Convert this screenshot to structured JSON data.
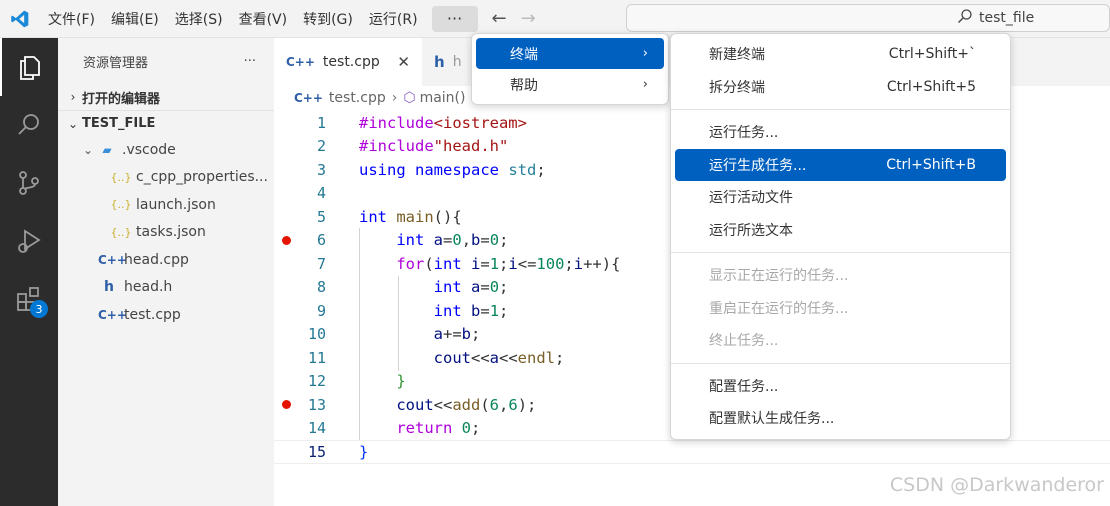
{
  "menubar": {
    "items": [
      "文件(F)",
      "编辑(E)",
      "选择(S)",
      "查看(V)",
      "转到(G)",
      "运行(R)"
    ],
    "more_label": "···"
  },
  "search": {
    "text": "test_file"
  },
  "activity": {
    "extensions_badge": "3"
  },
  "sidebar": {
    "title": "资源管理器",
    "more": "···",
    "open_editors": "打开的编辑器",
    "folder": "TEST_FILE",
    "tree": [
      {
        "label": ".vscode",
        "icon": "folder-icon"
      },
      {
        "label": "c_cpp_properties...",
        "icon": "json-icon"
      },
      {
        "label": "launch.json",
        "icon": "json-icon"
      },
      {
        "label": "tasks.json",
        "icon": "json-icon"
      },
      {
        "label": "head.cpp",
        "icon": "cpp-icon"
      },
      {
        "label": "head.h",
        "icon": "h-icon"
      },
      {
        "label": "test.cpp",
        "icon": "cpp-icon"
      }
    ]
  },
  "tabs": [
    {
      "label": "test.cpp",
      "icon": "C++"
    },
    {
      "label": "h",
      "icon": "h"
    }
  ],
  "breadcrumb": {
    "file": "test.cpp",
    "symbol": "main()"
  },
  "editor": {
    "line_numbers": [
      "1",
      "2",
      "3",
      "4",
      "5",
      "6",
      "7",
      "8",
      "9",
      "10",
      "11",
      "12",
      "13",
      "14",
      "15"
    ],
    "breakpoint_lines": [
      6,
      13
    ],
    "current_line": 15
  },
  "menu_primary": {
    "items": [
      {
        "label": "终端",
        "selected": true
      },
      {
        "label": "帮助",
        "selected": false
      }
    ]
  },
  "menu_terminal": {
    "groups": [
      [
        {
          "label": "新建终端",
          "shortcut": "Ctrl+Shift+`"
        },
        {
          "label": "拆分终端",
          "shortcut": "Ctrl+Shift+5"
        }
      ],
      [
        {
          "label": "运行任务...",
          "shortcut": ""
        },
        {
          "label": "运行生成任务...",
          "shortcut": "Ctrl+Shift+B",
          "selected": true
        },
        {
          "label": "运行活动文件",
          "shortcut": ""
        },
        {
          "label": "运行所选文本",
          "shortcut": ""
        }
      ],
      [
        {
          "label": "显示正在运行的任务...",
          "disabled": true
        },
        {
          "label": "重启正在运行的任务...",
          "disabled": true
        },
        {
          "label": "终止任务...",
          "disabled": true
        }
      ],
      [
        {
          "label": "配置任务...",
          "shortcut": ""
        },
        {
          "label": "配置默认生成任务...",
          "shortcut": ""
        }
      ]
    ]
  },
  "watermark": "CSDN @Darkwanderor",
  "colors": {
    "accent": "#0060c0",
    "breakpoint": "#e51400",
    "activitybar": "#2c2c2c"
  }
}
